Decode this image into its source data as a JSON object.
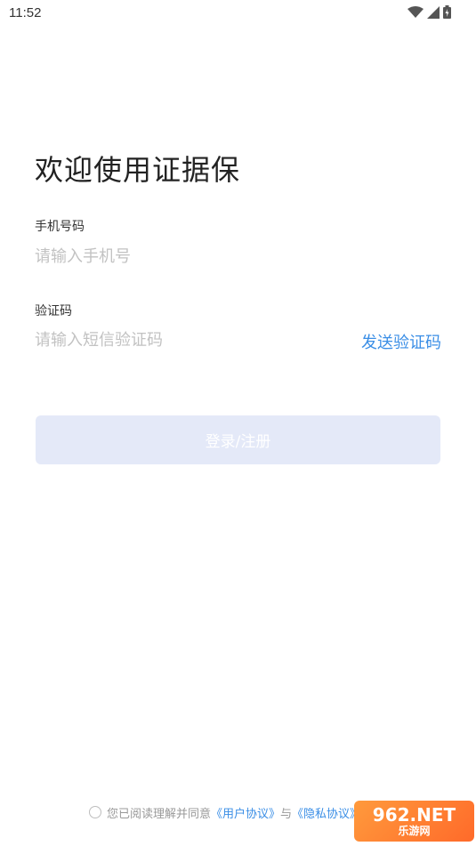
{
  "status": {
    "time": "11:52"
  },
  "header": {
    "title": "欢迎使用证据保"
  },
  "phone": {
    "label": "手机号码",
    "placeholder": "请输入手机号",
    "value": ""
  },
  "code": {
    "label": "验证码",
    "placeholder": "请输入短信验证码",
    "value": "",
    "send_label": "发送验证码"
  },
  "login": {
    "label": "登录/注册"
  },
  "agreement": {
    "prefix": "您已阅读理解并同意",
    "user_link": "《用户协议》",
    "and": "与",
    "privacy_link": "《隐私协议》"
  },
  "watermark": {
    "top": "962.NET",
    "bottom": "乐游网"
  },
  "colors": {
    "accent": "#3a8ee6",
    "button_bg": "#e4e9f8",
    "placeholder": "#c2c2c2"
  },
  "icons": [
    "wifi-icon",
    "signal-icon",
    "battery-icon"
  ]
}
